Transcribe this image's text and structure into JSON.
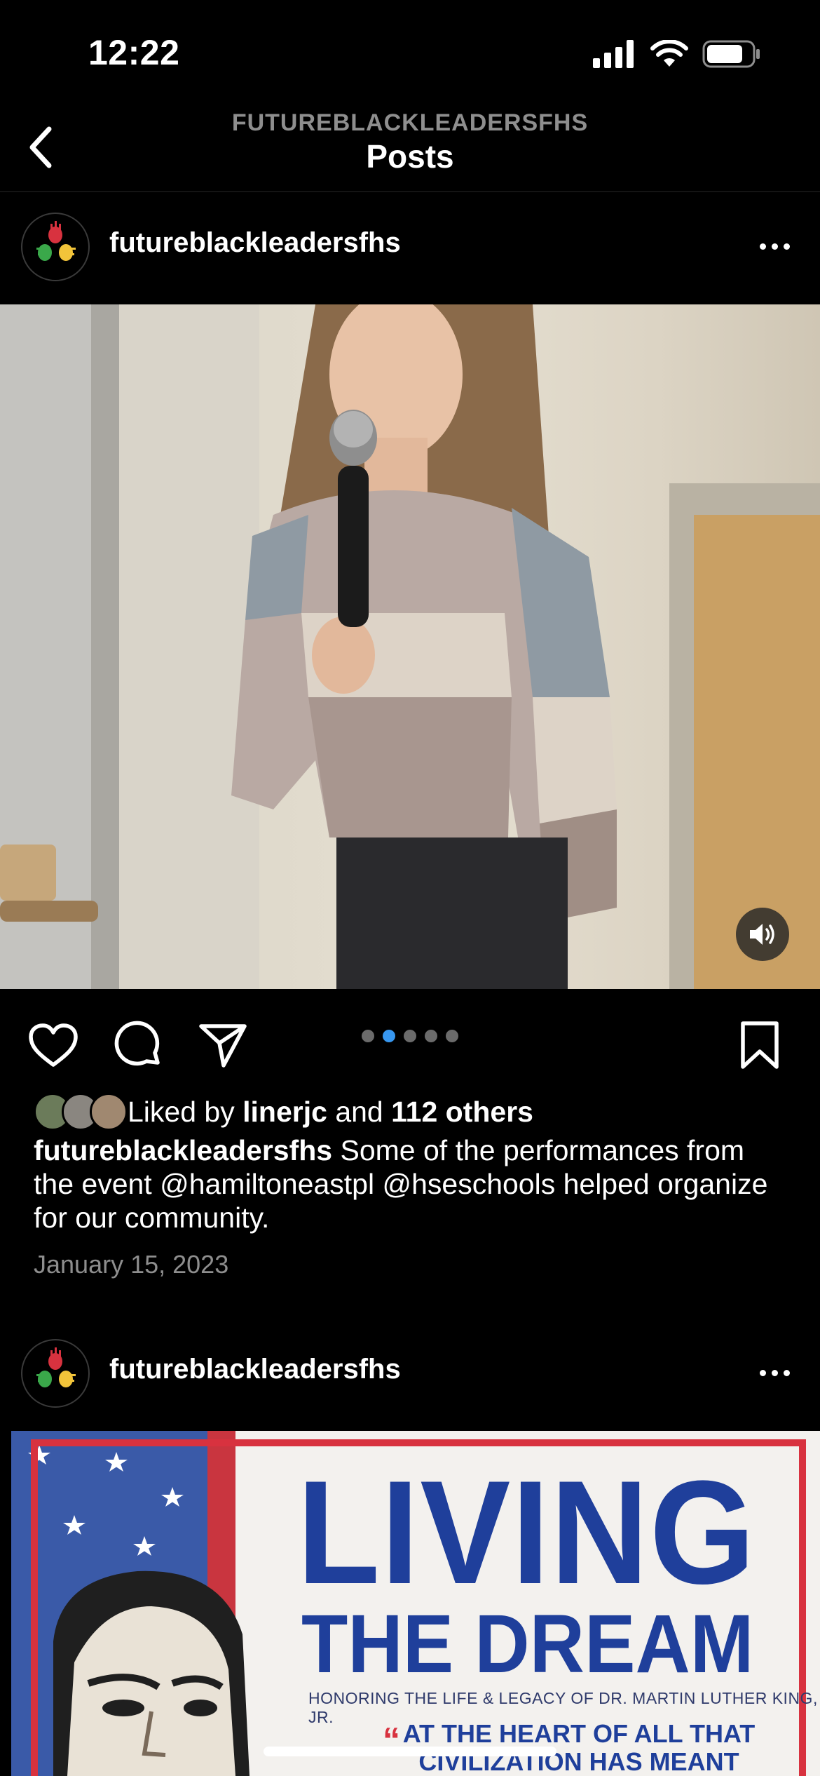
{
  "status_bar": {
    "time": "12:22"
  },
  "nav": {
    "account_label": "FUTUREBLACKLEADERSFHS",
    "title": "Posts"
  },
  "post1": {
    "username": "futureblackleadersfhs",
    "carousel": {
      "count": 5,
      "active_index": 1
    },
    "likes": {
      "prefix": "Liked by",
      "user": "linerjc",
      "joiner": "and",
      "others": "112 others"
    },
    "caption": {
      "username": "futureblackleadersfhs",
      "text": " Some of the performances from the event @hamiltoneastpl  @hseschools helped organize for our community."
    },
    "date": "January 15, 2023"
  },
  "post2": {
    "username": "futureblackleadersfhs",
    "poster": {
      "title_line1": "LIVING",
      "title_line2": "THE DREAM",
      "subtitle": "HONORING THE LIFE & LEGACY OF DR. MARTIN LUTHER KING, JR.",
      "quote": "AT THE HEART OF ALL THAT CIVILIZATION HAS MEANT"
    }
  },
  "icons": [
    "back-chevron-icon",
    "heart-icon",
    "comment-icon",
    "share-icon",
    "bookmark-icon",
    "more-icon",
    "speaker-icon"
  ],
  "colors": {
    "background": "#000000",
    "accent": "#3797f0",
    "secondary_text": "#8e8e8e"
  }
}
